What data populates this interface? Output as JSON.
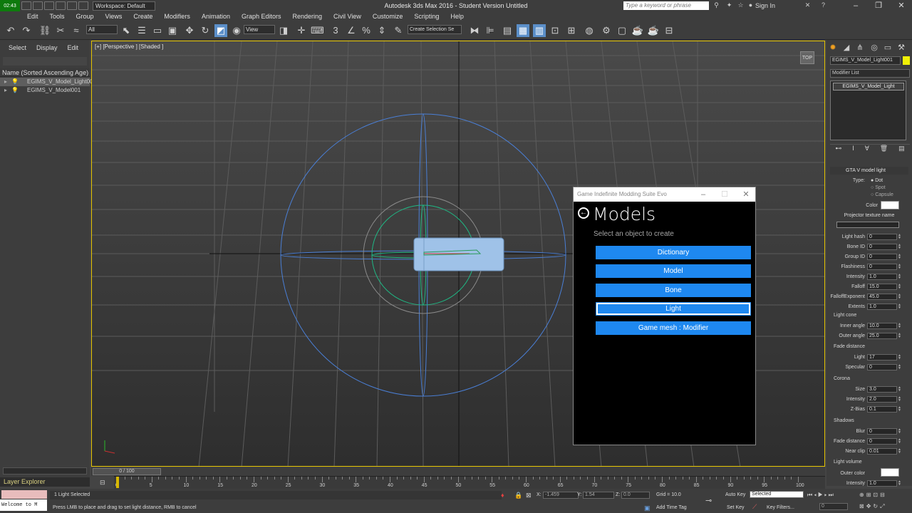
{
  "app": {
    "time": "02:43",
    "logo": "MAX",
    "workspace": "Workspace: Default",
    "title": "Autodesk 3ds Max 2016 - Student Version   Untitled",
    "keyword_placeholder": "Type a keyword or phrase",
    "sign_in": "Sign In"
  },
  "menu": [
    "Edit",
    "Tools",
    "Group",
    "Views",
    "Create",
    "Modifiers",
    "Animation",
    "Graph Editors",
    "Rendering",
    "Civil View",
    "Customize",
    "Scripting",
    "Help"
  ],
  "toolbar": {
    "selection_filter": "All",
    "ref_coord": "View",
    "named_selection": "Create Selection Se"
  },
  "explorer": {
    "tabs": [
      "Select",
      "Display",
      "Edit"
    ],
    "header": "Name (Sorted Ascending Age)",
    "rows": [
      "EGIMS_V_Model_Light001",
      "EGIMS_V_Model001"
    ],
    "footer": "Layer Explorer"
  },
  "viewport": {
    "label": "[+] [Perspective ] [Shaded ]",
    "nav": "TOP"
  },
  "command_panel": {
    "object_name": "EGIMS_V_Model_Light001",
    "object_color": "#f1f106",
    "modifier_list": "Modifier List",
    "stack_item": "EGIMS_V_Model_Light",
    "rollout_title": "GTA V model light",
    "type_label": "Type:",
    "types": [
      "Dot",
      "Spot",
      "Capsule"
    ],
    "color_label": "Color",
    "projector_label": "Projector texture name",
    "params": [
      {
        "label": "Light hash",
        "value": "0"
      },
      {
        "label": "Bone ID",
        "value": "0"
      },
      {
        "label": "Group ID",
        "value": "0"
      },
      {
        "label": "Flashiness",
        "value": "0"
      },
      {
        "label": "Intensity",
        "value": "1.0"
      },
      {
        "label": "Falloff",
        "value": "15.0"
      },
      {
        "label": "FalloffExponent",
        "value": "45.0"
      },
      {
        "label": "Extents",
        "value": "1.0"
      }
    ],
    "light_cone": {
      "title": "Light cone",
      "params": [
        {
          "label": "Inner angle",
          "value": "10.0"
        },
        {
          "label": "Outer angle",
          "value": "25.0"
        }
      ]
    },
    "fade_distance": {
      "title": "Fade distance",
      "params": [
        {
          "label": "Light",
          "value": "17"
        },
        {
          "label": "Specular",
          "value": "0"
        }
      ]
    },
    "corona": {
      "title": "Corona",
      "params": [
        {
          "label": "Size",
          "value": "3.0"
        },
        {
          "label": "Intensity",
          "value": "2.0"
        },
        {
          "label": "Z-Bias",
          "value": "0.1"
        }
      ]
    },
    "shadows": {
      "title": "Shadows",
      "params": [
        {
          "label": "Blur",
          "value": "0"
        },
        {
          "label": "Fade distance",
          "value": "0"
        },
        {
          "label": "Near clip",
          "value": "0.01"
        }
      ]
    },
    "light_volume": {
      "title": "Light volume",
      "params": [
        {
          "label": "Outer color",
          "value": ""
        },
        {
          "label": "Intensity",
          "value": "1.0"
        }
      ]
    }
  },
  "timeline": {
    "slider": "0 / 100",
    "ticks": [
      "0",
      "5",
      "10",
      "15",
      "20",
      "25",
      "30",
      "35",
      "40",
      "45",
      "50",
      "55",
      "60",
      "65",
      "70",
      "75",
      "80",
      "85",
      "90",
      "95",
      "100"
    ]
  },
  "status": {
    "maxscript": "Welcome to M",
    "selected": "1 Light Selected",
    "prompt": "Press LMB to place and drag to set light distance, RMB to cancel",
    "x_label": "X:",
    "x": "-1.459",
    "y_label": "Y:",
    "y": "1.54",
    "z_label": "Z:",
    "z": "0.0",
    "grid": "Grid = 10.0",
    "add_time_tag": "Add Time Tag",
    "auto_key": "Auto Key",
    "set_key": "Set Key",
    "selected_dd": "Selected",
    "key_filters": "Key Filters...",
    "frame": "0"
  },
  "dialog": {
    "window_title": "Game Indefinite Modding Suite Evo",
    "title": "Models",
    "subtitle": "Select an object to create",
    "buttons": [
      "Dictionary",
      "Model",
      "Bone",
      "Light",
      "Game mesh : Modifier"
    ],
    "button_color": "#1e88f0"
  }
}
